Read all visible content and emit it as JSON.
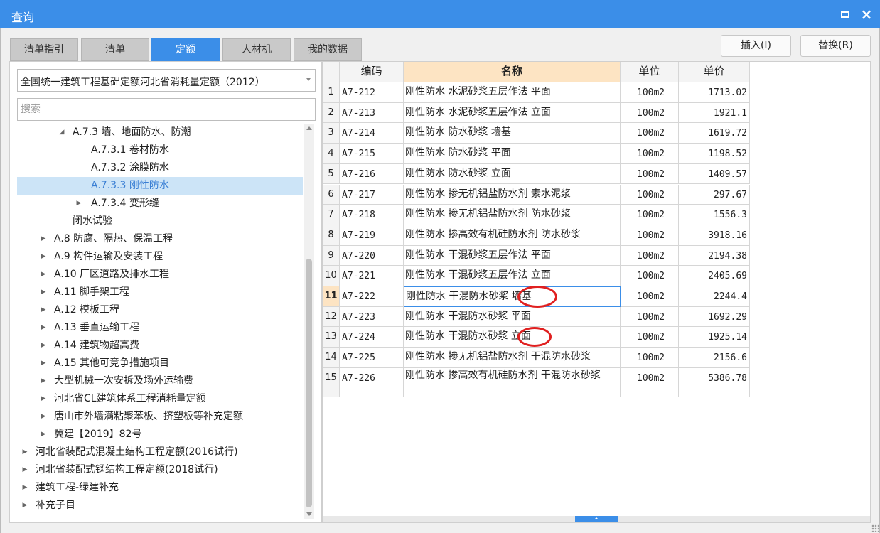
{
  "window": {
    "title": "查询"
  },
  "tabs": [
    {
      "label": "清单指引"
    },
    {
      "label": "清单"
    },
    {
      "label": "定额",
      "active": true
    },
    {
      "label": "人材机"
    },
    {
      "label": "我的数据"
    }
  ],
  "actions": {
    "insert_label": "插入(I)",
    "replace_label": "替换(R)"
  },
  "selector": {
    "value": "全国统一建筑工程基础定额河北省消耗量定额（2012）"
  },
  "search": {
    "placeholder": "搜索"
  },
  "tree": [
    {
      "label": "A.7.3 墙、地面防水、防潮",
      "level": 2,
      "arrow": "expanded"
    },
    {
      "label": "A.7.3.1 卷材防水",
      "level": 3,
      "arrow": "none"
    },
    {
      "label": "A.7.3.2 涂膜防水",
      "level": 3,
      "arrow": "none"
    },
    {
      "label": "A.7.3.3 刚性防水",
      "level": 3,
      "arrow": "none",
      "selected": true
    },
    {
      "label": "A.7.3.4 变形缝",
      "level": 3,
      "arrow": "collapsed"
    },
    {
      "label": "闭水试验",
      "level": 2,
      "arrow": "none"
    },
    {
      "label": "A.8 防腐、隔热、保温工程",
      "level": 1,
      "arrow": "collapsed"
    },
    {
      "label": "A.9 构件运输及安装工程",
      "level": 1,
      "arrow": "collapsed"
    },
    {
      "label": "A.10 厂区道路及排水工程",
      "level": 1,
      "arrow": "collapsed"
    },
    {
      "label": "A.11 脚手架工程",
      "level": 1,
      "arrow": "collapsed"
    },
    {
      "label": "A.12 模板工程",
      "level": 1,
      "arrow": "collapsed"
    },
    {
      "label": "A.13 垂直运输工程",
      "level": 1,
      "arrow": "collapsed"
    },
    {
      "label": "A.14 建筑物超高费",
      "level": 1,
      "arrow": "collapsed"
    },
    {
      "label": "A.15 其他可竞争措施项目",
      "level": 1,
      "arrow": "collapsed"
    },
    {
      "label": "大型机械一次安拆及场外运输费",
      "level": 1,
      "arrow": "collapsed"
    },
    {
      "label": "河北省CL建筑体系工程消耗量定额",
      "level": 1,
      "arrow": "collapsed"
    },
    {
      "label": "唐山市外墙满粘聚苯板、挤塑板等补充定额",
      "level": 1,
      "arrow": "collapsed"
    },
    {
      "label": "冀建【2019】82号",
      "level": 1,
      "arrow": "collapsed"
    },
    {
      "label": "河北省装配式混凝土结构工程定额(2016试行)",
      "level": 0,
      "arrow": "collapsed"
    },
    {
      "label": "河北省装配式钢结构工程定额(2018试行)",
      "level": 0,
      "arrow": "collapsed"
    },
    {
      "label": "建筑工程-绿建补充",
      "level": 0,
      "arrow": "collapsed"
    },
    {
      "label": "补充子目",
      "level": 0,
      "arrow": "collapsed"
    }
  ],
  "table": {
    "headers": {
      "code": "编码",
      "name": "名称",
      "unit": "单位",
      "price": "单价"
    },
    "current_row": 11,
    "rows": [
      {
        "num": "1",
        "code": "A7-212",
        "name": "刚性防水 水泥砂浆五层作法 平面",
        "unit": "100m2",
        "price": "1713.02"
      },
      {
        "num": "2",
        "code": "A7-213",
        "name": "刚性防水 水泥砂浆五层作法 立面",
        "unit": "100m2",
        "price": "1921.1"
      },
      {
        "num": "3",
        "code": "A7-214",
        "name": "刚性防水 防水砂浆 墙基",
        "unit": "100m2",
        "price": "1619.72"
      },
      {
        "num": "4",
        "code": "A7-215",
        "name": "刚性防水 防水砂浆 平面",
        "unit": "100m2",
        "price": "1198.52"
      },
      {
        "num": "5",
        "code": "A7-216",
        "name": "刚性防水 防水砂浆 立面",
        "unit": "100m2",
        "price": "1409.57"
      },
      {
        "num": "6",
        "code": "A7-217",
        "name": "刚性防水 掺无机铝盐防水剂 素水泥浆",
        "unit": "100m2",
        "price": "297.67"
      },
      {
        "num": "7",
        "code": "A7-218",
        "name": "刚性防水 掺无机铝盐防水剂 防水砂浆",
        "unit": "100m2",
        "price": "1556.3"
      },
      {
        "num": "8",
        "code": "A7-219",
        "name": "刚性防水 掺高效有机硅防水剂 防水砂浆",
        "unit": "100m2",
        "price": "3918.16"
      },
      {
        "num": "9",
        "code": "A7-220",
        "name": "刚性防水 干混砂浆五层作法 平面",
        "unit": "100m2",
        "price": "2194.38"
      },
      {
        "num": "10",
        "code": "A7-221",
        "name": "刚性防水 干混砂浆五层作法 立面",
        "unit": "100m2",
        "price": "2405.69"
      },
      {
        "num": "11",
        "code": "A7-222",
        "name": "刚性防水 干混防水砂浆 墙基",
        "unit": "100m2",
        "price": "2244.4"
      },
      {
        "num": "12",
        "code": "A7-223",
        "name": "刚性防水 干混防水砂浆 平面",
        "unit": "100m2",
        "price": "1692.29"
      },
      {
        "num": "13",
        "code": "A7-224",
        "name": "刚性防水 干混防水砂浆 立面",
        "unit": "100m2",
        "price": "1925.14"
      },
      {
        "num": "14",
        "code": "A7-225",
        "name": "刚性防水 掺无机铝盐防水剂 干混防水砂浆",
        "unit": "100m2",
        "price": "2156.6"
      },
      {
        "num": "15",
        "code": "A7-226",
        "name": "刚性防水 掺高效有机硅防水剂 干混防水砂浆",
        "unit": "100m2",
        "price": "5386.78"
      }
    ]
  },
  "colors": {
    "accent": "#3b8ee8",
    "selection": "#cce4f7",
    "header_highlight": "#fde4c3",
    "annotation": "#e02020"
  }
}
